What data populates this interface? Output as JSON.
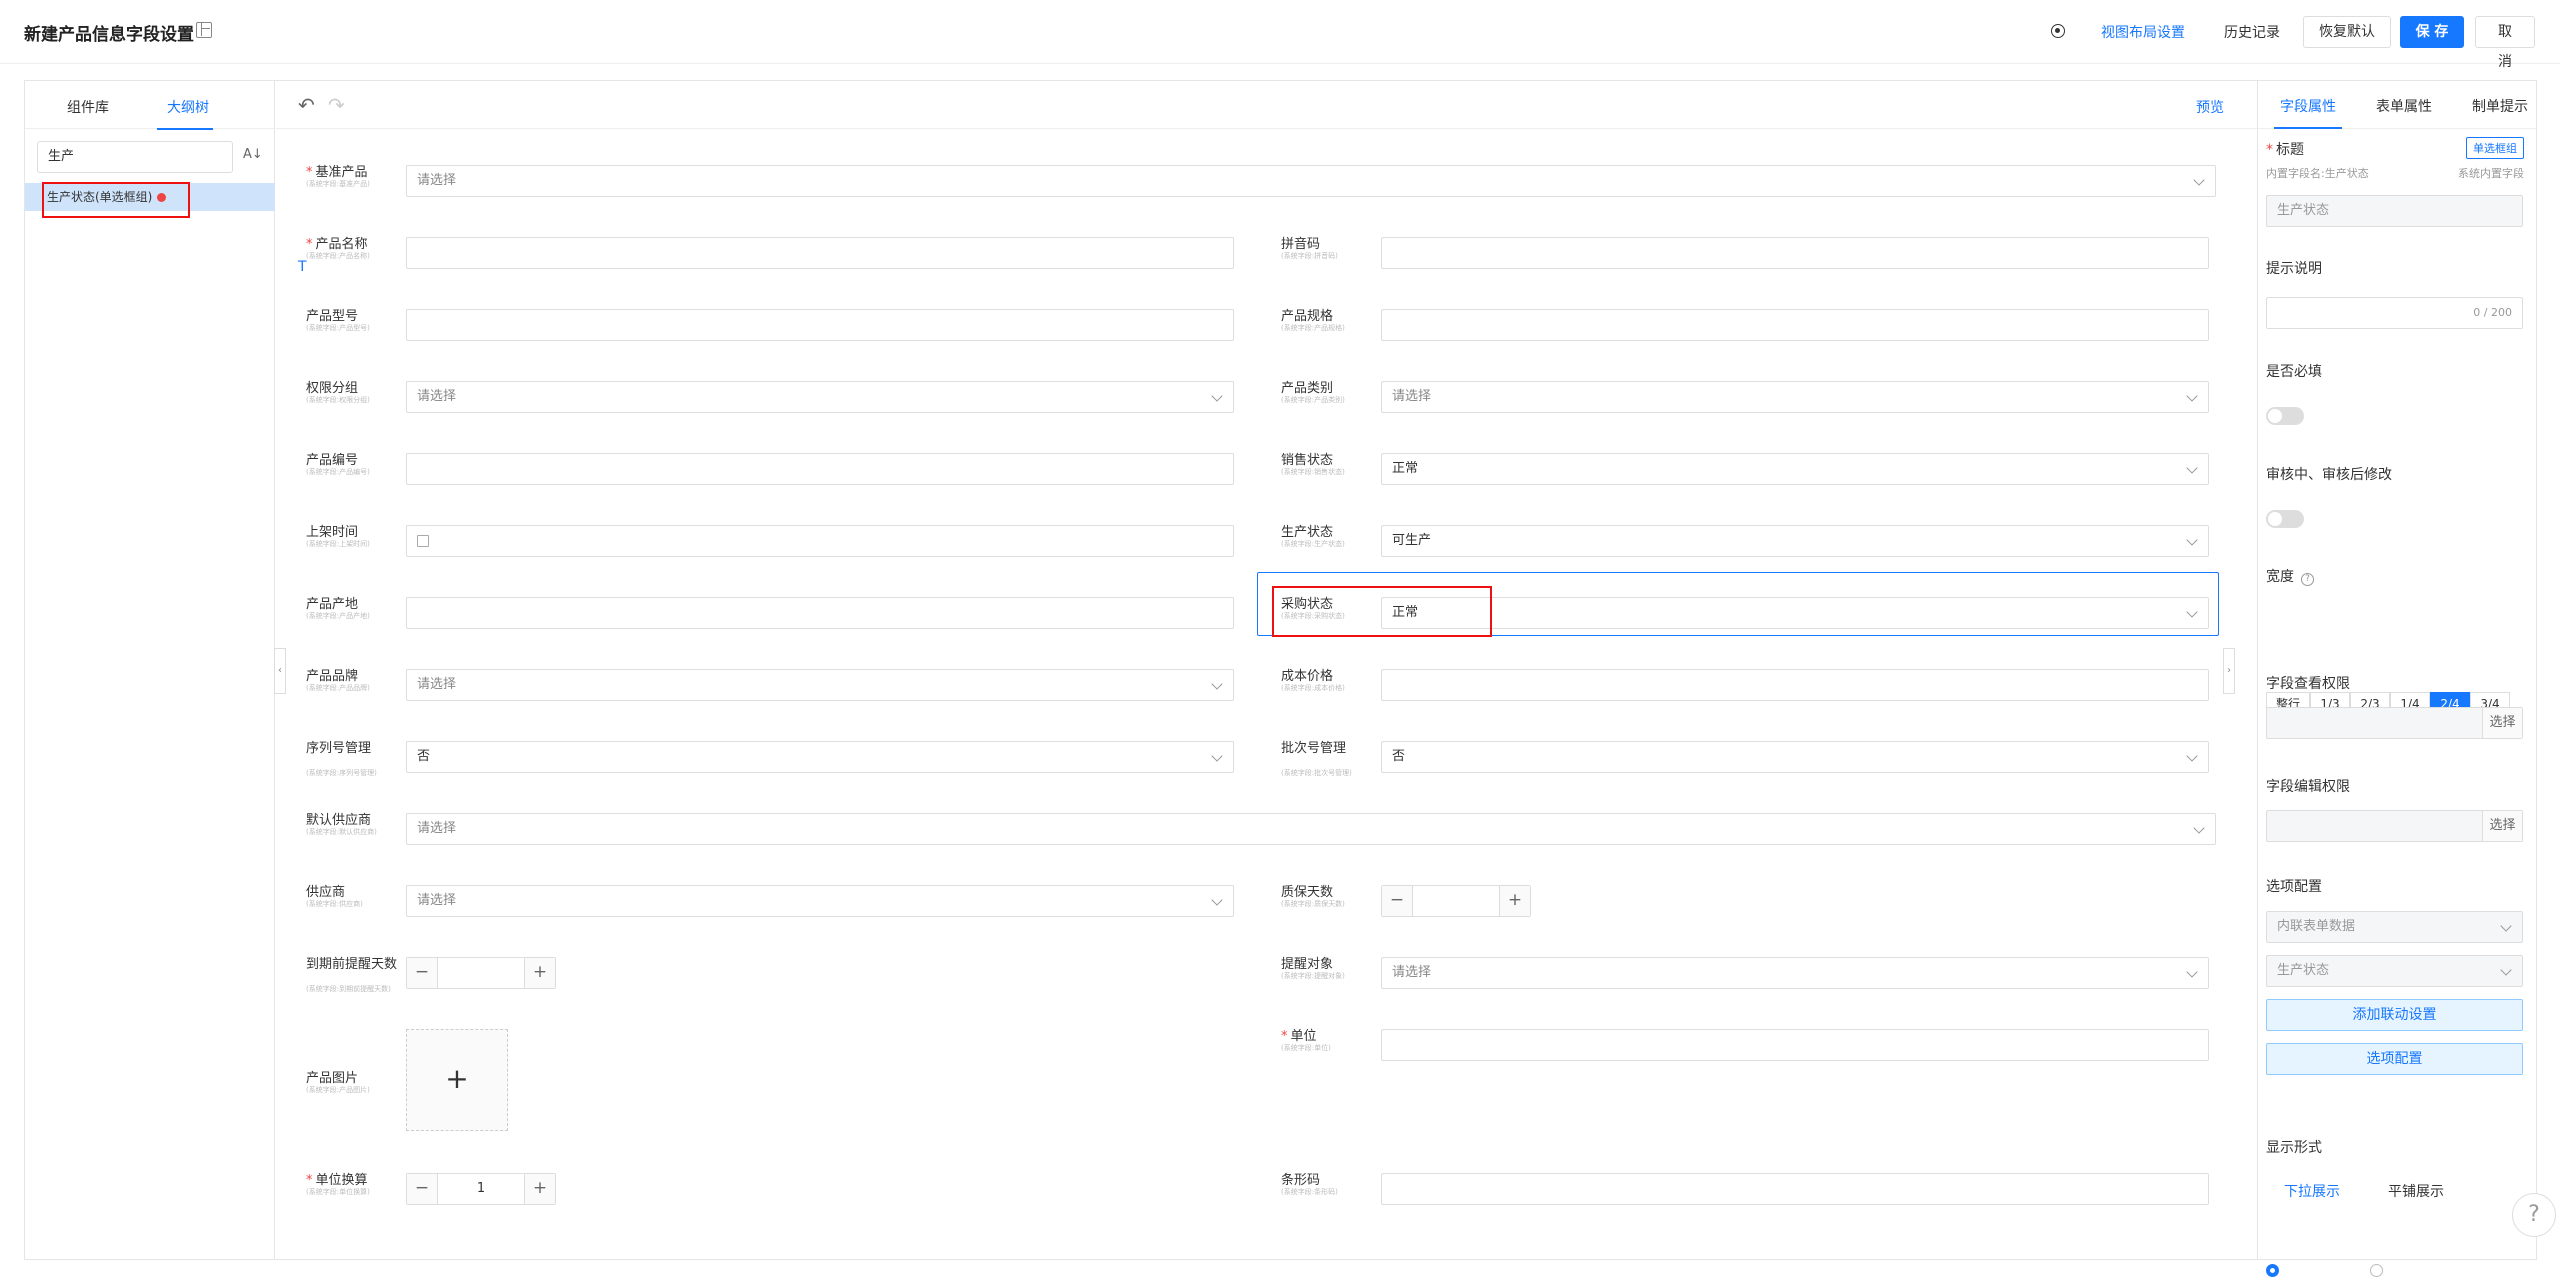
{
  "header": {
    "title": "新建产品信息字段设置",
    "actions": {
      "view_layout": "视图布局设置",
      "history": "历史记录",
      "restore": "恢复默认",
      "save": "保 存",
      "cancel": "取 消"
    }
  },
  "left": {
    "tabs": [
      "组件库",
      "大纲树"
    ],
    "search_value": "生产",
    "tree_items": [
      "生产状态(单选框组)"
    ]
  },
  "toolbar": {
    "preview": "预览"
  },
  "form": {
    "fields": [
      {
        "label": "基准产品",
        "sub": "(系统字段:基准产品)",
        "placeholder": "请选择",
        "required": "*"
      },
      {
        "label": "产品名称",
        "sub": "(系统字段:产品名称)",
        "required": "*"
      },
      {
        "label": "拼音码",
        "sub": "(系统字段:拼音码)"
      },
      {
        "label": "产品型号",
        "sub": "(系统字段:产品型号)"
      },
      {
        "label": "产品规格",
        "sub": "(系统字段:产品规格)"
      },
      {
        "label": "权限分组",
        "sub": "(系统字段:权限分组)",
        "placeholder": "请选择"
      },
      {
        "label": "产品类别",
        "sub": "(系统字段:产品类别)",
        "placeholder": "请选择"
      },
      {
        "label": "产品编号",
        "sub": "(系统字段:产品编号)"
      },
      {
        "label": "销售状态",
        "sub": "(系统字段:销售状态)",
        "value": "正常"
      },
      {
        "label": "上架时间",
        "sub": "(系统字段:上架时间)"
      },
      {
        "label": "生产状态",
        "sub": "(系统字段:生产状态)",
        "value": "可生产"
      },
      {
        "label": "产品产地",
        "sub": "(系统字段:产品产地)"
      },
      {
        "label": "采购状态",
        "sub": "(系统字段:采购状态)",
        "value": "正常"
      },
      {
        "label": "产品品牌",
        "sub": "(系统字段:产品品牌)",
        "placeholder": "请选择"
      },
      {
        "label": "成本价格",
        "sub": "(系统字段:成本价格)"
      },
      {
        "label": "序列号管理",
        "sub": "(系统字段:序列号管理)",
        "value": "否"
      },
      {
        "label": "批次号管理",
        "sub": "(系统字段:批次号管理)",
        "value": "否"
      },
      {
        "label": "默认供应商",
        "sub": "(系统字段:默认供应商)",
        "placeholder": "请选择"
      },
      {
        "label": "供应商",
        "sub": "(系统字段:供应商)",
        "placeholder": "请选择"
      },
      {
        "label": "质保天数",
        "sub": "(系统字段:质保天数)"
      },
      {
        "label": "到期前提醒天数",
        "sub": "(系统字段:到期前提醒天数)"
      },
      {
        "label": "提醒对象",
        "sub": "(系统字段:提醒对象)",
        "placeholder": "请选择"
      },
      {
        "label": "单位",
        "sub": "(系统字段:单位)",
        "required": "*"
      },
      {
        "label": "产品图片",
        "sub": "(系统字段:产品图片)"
      },
      {
        "label": "单位换算",
        "sub": "(系统字段:单位换算)",
        "required": "*",
        "value": "1"
      },
      {
        "label": "条形码",
        "sub": "(系统字段:条形码)"
      }
    ]
  },
  "right": {
    "tabs": [
      "字段属性",
      "表单属性",
      "制单提示"
    ],
    "title_label": "标题",
    "title_tag": "单选框组",
    "builtin_name": "内置字段名:生产状态",
    "system_field": "系统内置字段",
    "title_value": "生产状态",
    "tip_label": "提示说明",
    "counter": "0 / 200",
    "required_label": "是否必填",
    "modify_label": "审核中、审核后修改",
    "width_label": "宽度",
    "width_options": [
      "整行",
      "1/3",
      "2/3",
      "1/4",
      "2/4",
      "3/4"
    ],
    "view_perm": "字段查看权限",
    "edit_perm": "字段编辑权限",
    "choose": "选择",
    "options_label": "选项配置",
    "option_source": "内联表单数据",
    "option_value": "生产状态",
    "linkage_button": "添加联动设置",
    "options_button": "选项配置",
    "display_label": "显示形式",
    "display_options": [
      "下拉展示",
      "平铺展示"
    ]
  }
}
